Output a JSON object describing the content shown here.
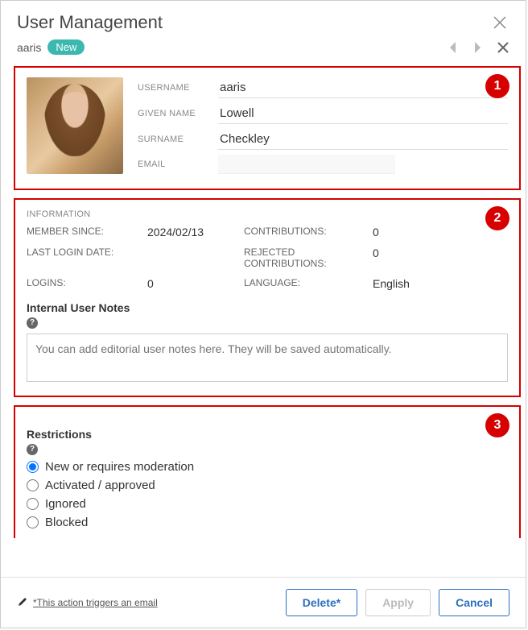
{
  "header": {
    "title": "User Management"
  },
  "subheader": {
    "username": "aaris",
    "badge": "New"
  },
  "annotations": {
    "b1": "1",
    "b2": "2",
    "b3": "3"
  },
  "profile": {
    "labels": {
      "username": "USERNAME",
      "given_name": "GIVEN NAME",
      "surname": "SURNAME",
      "email": "EMAIL"
    },
    "values": {
      "username": "aaris",
      "given_name": "Lowell",
      "surname": "Checkley",
      "email": ""
    }
  },
  "info": {
    "heading": "INFORMATION",
    "labels": {
      "member_since": "MEMBER SINCE:",
      "last_login": "LAST LOGIN DATE:",
      "logins": "LOGINS:",
      "contributions": "CONTRIBUTIONS:",
      "rejected": "REJECTED CONTRIBUTIONS:",
      "language": "LANGUAGE:"
    },
    "values": {
      "member_since": "2024/02/13",
      "last_login": "",
      "logins": "0",
      "contributions": "0",
      "rejected": "0",
      "language": "English"
    }
  },
  "notes": {
    "title": "Internal User Notes",
    "placeholder": "You can add editorial user notes here. They will be saved automatically."
  },
  "restrictions": {
    "title": "Restrictions",
    "options": {
      "new": "New or requires moderation",
      "activated": "Activated / approved",
      "ignored": "Ignored",
      "blocked": "Blocked"
    }
  },
  "footer": {
    "hint": "*This action triggers an email",
    "buttons": {
      "delete": "Delete*",
      "apply": "Apply",
      "cancel": "Cancel"
    }
  }
}
